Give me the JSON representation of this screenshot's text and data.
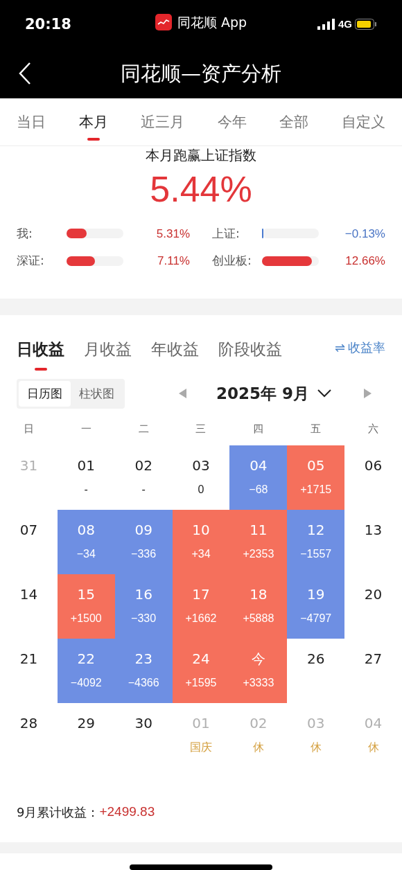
{
  "status_bar": {
    "time": "20:18",
    "app_name": "同花顺 App",
    "network": "4G"
  },
  "nav": {
    "title": "同花顺—资产分析"
  },
  "period_tabs": [
    {
      "label": "当日",
      "selected": false
    },
    {
      "label": "本月",
      "selected": true
    },
    {
      "label": "近三月",
      "selected": false
    },
    {
      "label": "今年",
      "selected": false
    },
    {
      "label": "全部",
      "selected": false
    },
    {
      "label": "自定义",
      "selected": false
    }
  ],
  "summary": {
    "heading": "本月跑赢上证指数",
    "value": "5.44%",
    "bars": [
      {
        "label": "我:",
        "level": 0.35,
        "reading": "5.31%",
        "kind": "up"
      },
      {
        "label": "上证:",
        "level": 0.01,
        "reading": "−0.13%",
        "kind": "down"
      },
      {
        "label": "深证:",
        "level": 0.5,
        "reading": "7.11%",
        "kind": "up"
      },
      {
        "label": "创业板:",
        "level": 0.88,
        "reading": "12.66%",
        "kind": "up"
      }
    ]
  },
  "earning_tabs": [
    {
      "label": "日收益",
      "selected": true
    },
    {
      "label": "月收益",
      "selected": false
    },
    {
      "label": "年收益",
      "selected": false
    },
    {
      "label": "阶段收益",
      "selected": false
    }
  ],
  "rate_toggle": {
    "icon": "⇌",
    "label": "收益率"
  },
  "view_switch": [
    {
      "label": "日历图",
      "selected": true
    },
    {
      "label": "柱状图",
      "selected": false
    }
  ],
  "month_picker": {
    "label": "2025年 9月"
  },
  "weekdays": [
    "日",
    "一",
    "二",
    "三",
    "四",
    "五",
    "六"
  ],
  "weeks": [
    [
      {
        "day": "31",
        "kind": "other"
      },
      {
        "day": "01",
        "value": "-",
        "kind": "plain"
      },
      {
        "day": "02",
        "value": "-",
        "kind": "plain"
      },
      {
        "day": "03",
        "value": "0",
        "kind": "plain"
      },
      {
        "day": "04",
        "value": "−68",
        "kind": "loss"
      },
      {
        "day": "05",
        "value": "+1715",
        "kind": "gain"
      },
      {
        "day": "06",
        "kind": "plain"
      }
    ],
    [
      {
        "day": "07",
        "kind": "plain"
      },
      {
        "day": "08",
        "value": "−34",
        "kind": "loss"
      },
      {
        "day": "09",
        "value": "−336",
        "kind": "loss"
      },
      {
        "day": "10",
        "value": "+34",
        "kind": "gain"
      },
      {
        "day": "11",
        "value": "+2353",
        "kind": "gain"
      },
      {
        "day": "12",
        "value": "−1557",
        "kind": "loss"
      },
      {
        "day": "13",
        "kind": "plain"
      }
    ],
    [
      {
        "day": "14",
        "kind": "plain"
      },
      {
        "day": "15",
        "value": "+1500",
        "kind": "gain"
      },
      {
        "day": "16",
        "value": "−330",
        "kind": "loss"
      },
      {
        "day": "17",
        "value": "+1662",
        "kind": "gain"
      },
      {
        "day": "18",
        "value": "+5888",
        "kind": "gain"
      },
      {
        "day": "19",
        "value": "−4797",
        "kind": "loss"
      },
      {
        "day": "20",
        "kind": "plain"
      }
    ],
    [
      {
        "day": "21",
        "kind": "plain"
      },
      {
        "day": "22",
        "value": "−4092",
        "kind": "loss"
      },
      {
        "day": "23",
        "value": "−4366",
        "kind": "loss"
      },
      {
        "day": "24",
        "value": "+1595",
        "kind": "gain"
      },
      {
        "day": "今",
        "value": "+3333",
        "kind": "gain"
      },
      {
        "day": "26",
        "kind": "plain"
      },
      {
        "day": "27",
        "kind": "plain"
      }
    ],
    [
      {
        "day": "28",
        "kind": "plain"
      },
      {
        "day": "29",
        "kind": "plain"
      },
      {
        "day": "30",
        "kind": "plain"
      },
      {
        "day": "01",
        "kind": "other",
        "note": "国庆"
      },
      {
        "day": "02",
        "kind": "other",
        "note": "休"
      },
      {
        "day": "03",
        "kind": "other",
        "note": "休"
      },
      {
        "day": "04",
        "kind": "other",
        "note": "休"
      }
    ]
  ],
  "month_total": {
    "label": "9月累计收益：",
    "value": "+2499.83"
  }
}
